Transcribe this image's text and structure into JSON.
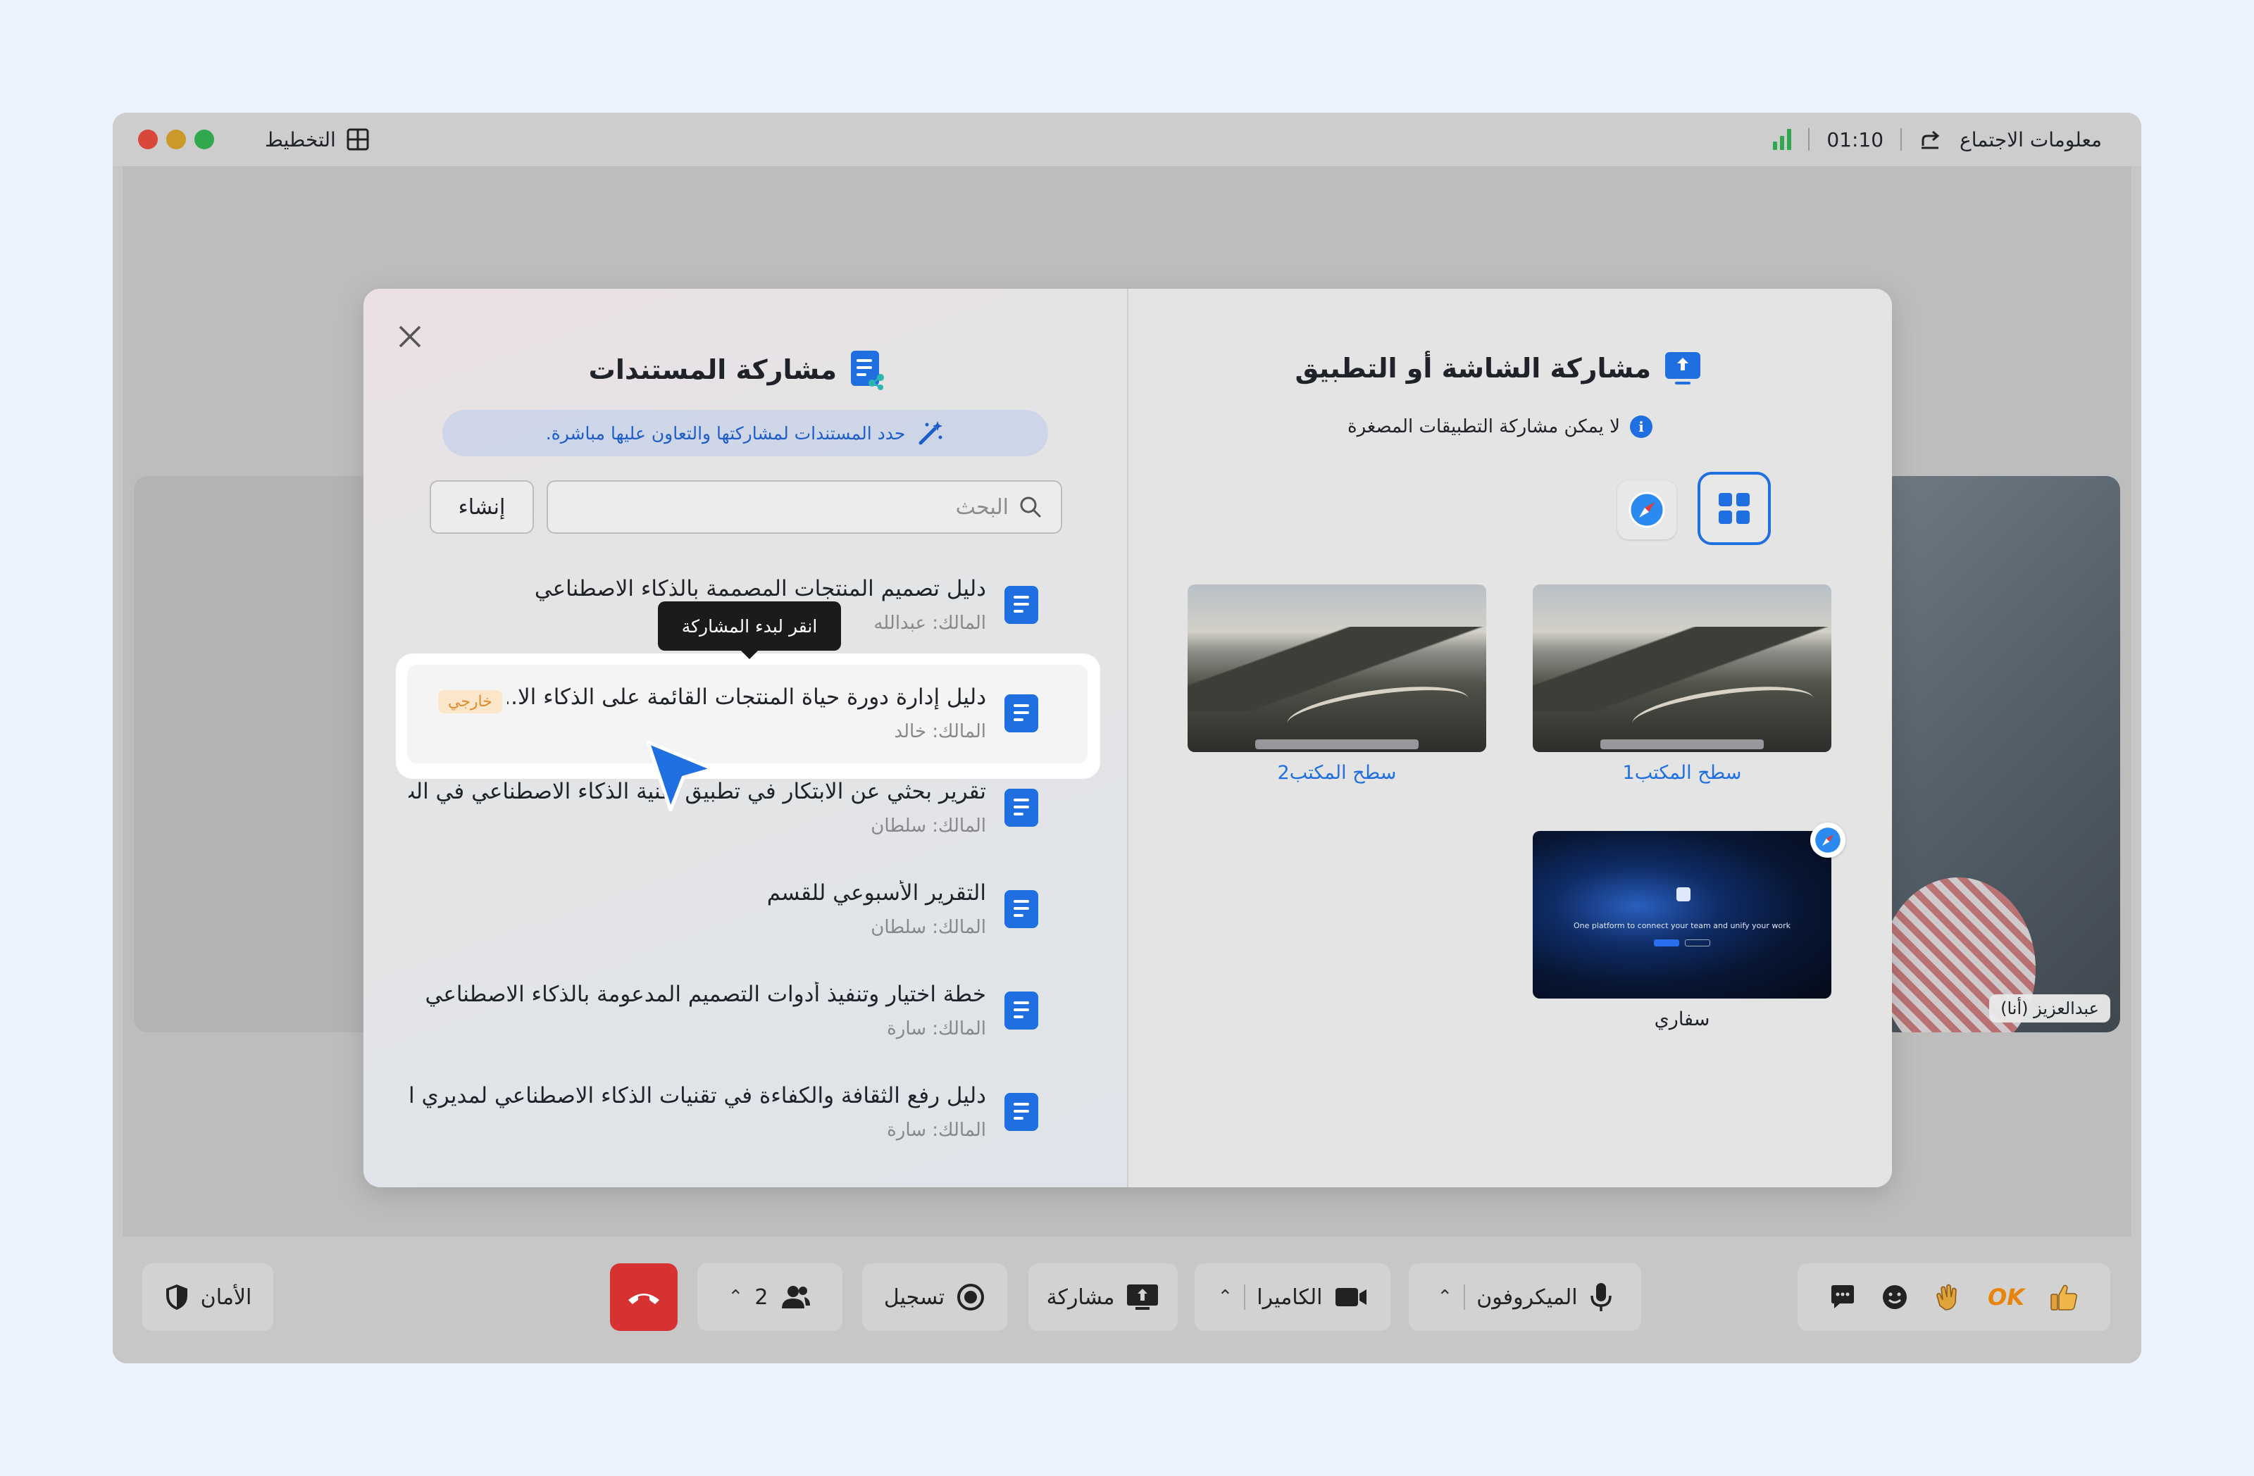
{
  "titlebar": {
    "layout_label": "التخطيط",
    "timer": "01:10",
    "meeting_info": "معلومات الاجتماع"
  },
  "participant": {
    "name": "عبدالعزيز (أنا)"
  },
  "doc_panel": {
    "title": "مشاركة المستندات",
    "banner": "حدد المستندات لمشاركتها والتعاون عليها مباشرة.",
    "search_placeholder": "البحث",
    "create_label": "إنشاء",
    "tooltip": "انقر لبدء المشاركة",
    "documents": [
      {
        "title": "دليل تصميم المنتجات المصممة بالذكاء الاصطناعي",
        "owner": "المالك: عبدالله"
      },
      {
        "title": "دليل إدارة دورة حياة المنتجات القائمة على الذكاء الا...",
        "owner": "المالك: خالد",
        "badge": "خارجي"
      },
      {
        "title": "تقرير بحثي عن الابتكار في تطبيق تقنية الذكاء الاصطناعي في الت...",
        "owner": "المالك: سلطان"
      },
      {
        "title": "التقرير الأسبوعي للقسم",
        "owner": "المالك: سلطان"
      },
      {
        "title": "خطة اختيار وتنفيذ أدوات التصميم المدعومة بالذكاء الاصطناعي",
        "owner": "المالك: سارة"
      },
      {
        "title": "دليل رفع الثقافة والكفاءة في تقنيات الذكاء الاصطناعي لمديري ا...",
        "owner": "المالك: سارة"
      }
    ]
  },
  "screen_panel": {
    "title": "مشاركة الشاشة أو التطبيق",
    "note": "لا يمكن مشاركة التطبيقات المصغرة",
    "screens": [
      {
        "label": "سطح المكتب1"
      },
      {
        "label": "سطح المكتب2"
      },
      {
        "label": "سفاري",
        "hero_text": "One platform to connect your team and unify your work"
      }
    ]
  },
  "toolbar": {
    "security": "الأمان",
    "participants_count": "2",
    "record": "تسجيل",
    "share": "مشاركة",
    "camera": "الكاميرا",
    "microphone": "الميكروفون",
    "reaction_ok": "OK"
  },
  "colors": {
    "accent": "#1f6fe0",
    "end_call": "#d63232",
    "badge_external": "#e08a2c"
  }
}
